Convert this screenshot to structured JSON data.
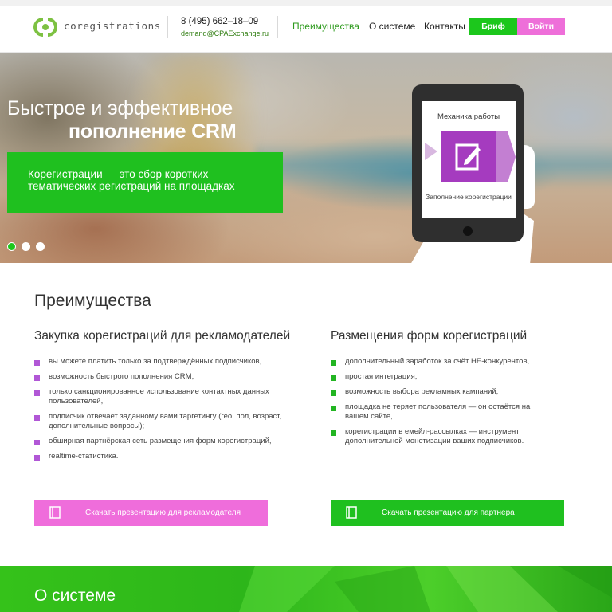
{
  "header": {
    "logo_text": "coregistrations",
    "phone": "8 (495) 662–18–09",
    "email": "demand@CPAExchange.ru",
    "nav": [
      {
        "label": "Преимущества",
        "active": true
      },
      {
        "label": "О системе",
        "active": false
      },
      {
        "label": "Контакты",
        "active": false
      }
    ],
    "brief_label": "Бриф",
    "login_label": "Войти"
  },
  "hero": {
    "title_line1": "Быстрое и эффективное",
    "title_line2": "пополнение CRM",
    "subtitle": "Корегистрации — это сбор коротких тематических регистраций на площадках",
    "slides_total": 3,
    "active_slide": 1,
    "tablet": {
      "title": "Механика работы",
      "caption": "Заполнение корегистрации"
    }
  },
  "advantages": {
    "title": "Преимущества",
    "advertisers": {
      "title": "Закупка корегистраций для рекламодателей",
      "items": [
        "вы можете платить только за подтверждённых подписчиков,",
        "возможность быстрого пополнения CRM,",
        "только санкционированное использование контактных данных пользователей,",
        "подписчик отвечает заданному вами таргетингу (гео, пол, возраст, дополнительные вопросы);",
        "обширная партнёрская сеть размещения форм корегистраций,",
        "realtime-статистика."
      ],
      "cta": "Скачать презентацию для рекламодателя"
    },
    "partners": {
      "title": "Размещения форм корегистраций",
      "items": [
        "дополнительный заработок за счёт НЕ-конкурентов,",
        "простая интеграция,",
        "возможность выбора рекламных кампаний,",
        "площадка не теряет пользователя — он остаётся на вашем сайте,",
        "корегистрации в емейл-рассылках — инструмент дополнительной монетизации ваших подписчиков."
      ],
      "cta": "Скачать презентацию для партнера"
    }
  },
  "about": {
    "title": "О системе"
  },
  "colors": {
    "brand_green": "#1cc71c",
    "brand_pink": "#ee6fd9",
    "bullet_purple": "#b157d6",
    "bullet_green": "#22b522"
  }
}
